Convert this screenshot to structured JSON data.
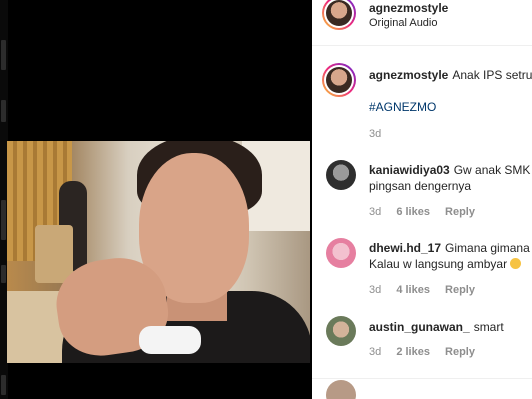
{
  "post": {
    "author": "agnezmostyle",
    "audio": "Original Audio"
  },
  "caption": {
    "username": "agnezmostyle",
    "text": "Anak IPS setru",
    "hashtag": "#AGNEZMO",
    "time": "3d"
  },
  "comments": [
    {
      "username": "kaniawidiya03",
      "line1": "Gw anak SMK",
      "line2": "pingsan dengernya",
      "time": "3d",
      "likes": "6 likes",
      "reply": "Reply"
    },
    {
      "username": "dhewi.hd_17",
      "line1": "Gimana gimana",
      "line2": "Kalau w langsung ambyar",
      "emoji": "face-with-spiral-eyes-emoji",
      "time": "3d",
      "likes": "4 likes",
      "reply": "Reply"
    },
    {
      "username": "austin_gunawan_",
      "line1": "smart",
      "time": "3d",
      "likes": "2 likes",
      "reply": "Reply"
    }
  ],
  "colors": {
    "username": "#262626",
    "meta": "#8e8e8e",
    "hashtag": "#00376b",
    "divider": "#efefef"
  }
}
